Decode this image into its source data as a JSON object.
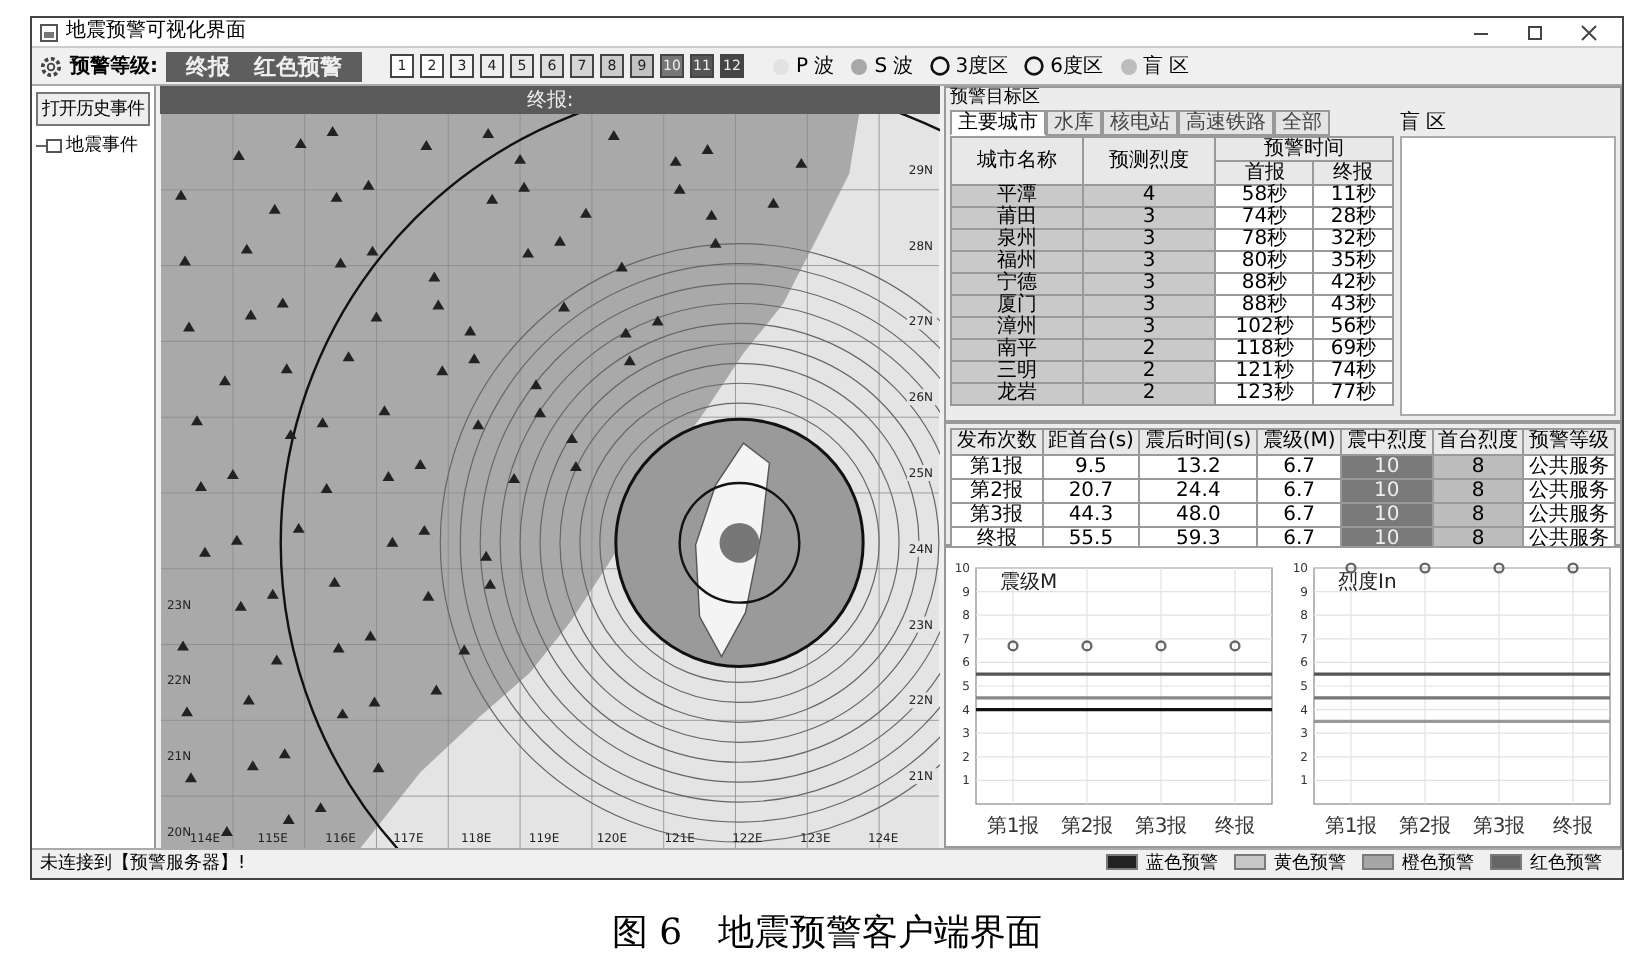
{
  "window": {
    "title": "地震预警可视化界面"
  },
  "toolbar": {
    "label": "预警等级:",
    "report": "终报",
    "level": "红色预警",
    "intensity_scale": [
      {
        "label": "1",
        "color": "#ffffff"
      },
      {
        "label": "2",
        "color": "#ffffff"
      },
      {
        "label": "3",
        "color": "#f4f4f4"
      },
      {
        "label": "4",
        "color": "#eeeeee"
      },
      {
        "label": "5",
        "color": "#e6e6e6"
      },
      {
        "label": "6",
        "color": "#dddddd"
      },
      {
        "label": "7",
        "color": "#d4d4d4"
      },
      {
        "label": "8",
        "color": "#cccccc"
      },
      {
        "label": "9",
        "color": "#c2c2c2"
      },
      {
        "label": "10",
        "color": "#777777"
      },
      {
        "label": "11",
        "color": "#555555"
      },
      {
        "label": "12",
        "color": "#444444"
      }
    ],
    "legend": [
      {
        "kind": "dot",
        "label": "P 波",
        "color": "#e2e2e2"
      },
      {
        "kind": "dot",
        "label": "S 波",
        "color": "#a8a8a8"
      },
      {
        "kind": "ring",
        "label": "3度区"
      },
      {
        "kind": "ring",
        "label": "6度区"
      },
      {
        "kind": "dot",
        "label": "盲 区",
        "color": "#bdbdbd"
      }
    ]
  },
  "left_panel": {
    "button": "打开历史事件",
    "tree": [
      {
        "label": "地震事件"
      }
    ]
  },
  "map": {
    "title": "终报:",
    "lat_labels_left": [
      "23N",
      "22N",
      "21N",
      "20N"
    ],
    "lat_labels_right": [
      "29N",
      "28N",
      "27N",
      "26N",
      "25N",
      "24N",
      "23N",
      "22N",
      "21N"
    ],
    "lon_labels": [
      "114E",
      "115E",
      "116E",
      "117E",
      "118E",
      "119E",
      "120E",
      "121E",
      "122E",
      "123E",
      "124E"
    ]
  },
  "target_area": {
    "title": "预警目标区",
    "tabs": [
      {
        "label": "主要城市",
        "selected": true
      },
      {
        "label": "水库",
        "selected": false
      },
      {
        "label": "核电站",
        "selected": false
      },
      {
        "label": "高速铁路",
        "selected": false
      },
      {
        "label": "全部",
        "selected": false
      }
    ],
    "columns": [
      "城市名称",
      "预测烈度"
    ],
    "group_header": "预警时间",
    "subcolumns": [
      "首报",
      "终报"
    ],
    "rows": [
      [
        "平潭",
        "4",
        "58秒",
        "11秒"
      ],
      [
        "莆田",
        "3",
        "74秒",
        "28秒"
      ],
      [
        "泉州",
        "3",
        "78秒",
        "32秒"
      ],
      [
        "福州",
        "3",
        "80秒",
        "35秒"
      ],
      [
        "宁德",
        "3",
        "88秒",
        "42秒"
      ],
      [
        "厦门",
        "3",
        "88秒",
        "43秒"
      ],
      [
        "漳州",
        "3",
        "102秒",
        "56秒"
      ],
      [
        "南平",
        "2",
        "118秒",
        "69秒"
      ],
      [
        "三明",
        "2",
        "121秒",
        "74秒"
      ],
      [
        "龙岩",
        "2",
        "123秒",
        "77秒"
      ]
    ],
    "blind_zone": {
      "title": "盲 区"
    }
  },
  "reports": {
    "columns": [
      "发布次数",
      "距首台(s)",
      "震后时间(s)",
      "震级(M)",
      "震中烈度",
      "首台烈度",
      "预警等级"
    ],
    "rows": [
      [
        "第1报",
        "9.5",
        "13.2",
        "6.7",
        "10",
        "8",
        "公共服务"
      ],
      [
        "第2报",
        "20.7",
        "24.4",
        "6.7",
        "10",
        "8",
        "公共服务"
      ],
      [
        "第3报",
        "44.3",
        "48.0",
        "6.7",
        "10",
        "8",
        "公共服务"
      ],
      [
        "终报",
        "55.5",
        "59.3",
        "6.7",
        "10",
        "8",
        "公共服务"
      ]
    ]
  },
  "charts": [
    {
      "chart_data": {
        "type": "scatter",
        "title": "震级M",
        "categories": [
          "第1报",
          "第2报",
          "第3报",
          "终报"
        ],
        "series": [
          {
            "color": "#666666",
            "values": [
              6.7,
              6.7,
              6.7,
              6.7
            ]
          }
        ],
        "ylim": [
          0,
          10
        ],
        "yticks": [
          1,
          2,
          3,
          4,
          5,
          6,
          7,
          8,
          9,
          10
        ],
        "grid": true,
        "ref_lines": [
          {
            "axis": "y",
            "value": 5.5,
            "color": "#555555"
          },
          {
            "axis": "y",
            "value": 4.5,
            "color": "#888888"
          },
          {
            "axis": "y",
            "value": 4,
            "color": "#111111"
          }
        ]
      }
    },
    {
      "chart_data": {
        "type": "scatter",
        "title": "烈度In",
        "categories": [
          "第1报",
          "第2报",
          "第3报",
          "终报"
        ],
        "series": [
          {
            "color": "#666666",
            "values": [
              10,
              10,
              10,
              10
            ]
          }
        ],
        "ylim": [
          0,
          10
        ],
        "yticks": [
          1,
          2,
          3,
          4,
          5,
          6,
          7,
          8,
          9,
          10
        ],
        "grid": true,
        "ref_lines": [
          {
            "axis": "y",
            "value": 5.5,
            "color": "#555555"
          },
          {
            "axis": "y",
            "value": 4.5,
            "color": "#777777"
          },
          {
            "axis": "y",
            "value": 3.5,
            "color": "#999999"
          }
        ]
      }
    }
  ],
  "status_bar": {
    "message": "未连接到【预警服务器】!",
    "legend": [
      {
        "label": "蓝色预警",
        "color": "#222222"
      },
      {
        "label": "黄色预警",
        "color": "#c8c8c8"
      },
      {
        "label": "橙色预警",
        "color": "#a6a6a6"
      },
      {
        "label": "红色预警",
        "color": "#666666"
      }
    ]
  },
  "caption": "图 6　地震预警客户端界面"
}
